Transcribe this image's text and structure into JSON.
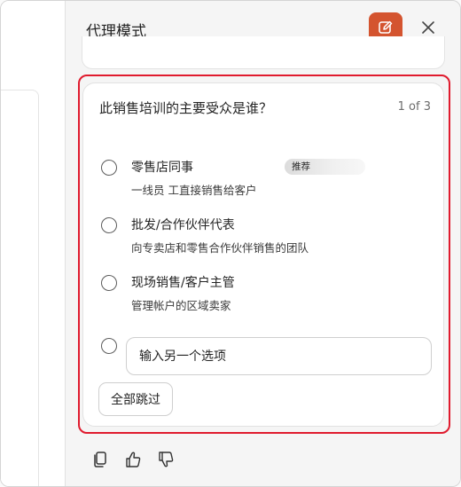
{
  "panel": {
    "title": "代理模式",
    "compose_icon": "compose-icon",
    "close_icon": "close-icon",
    "accent_color": "#d4542f",
    "highlight_color": "#e01b2e"
  },
  "question": {
    "text": "此销售培训的主要受众是谁？",
    "counter": "1 of 3",
    "options": [
      {
        "title": "零售店同事",
        "badge": "推荐",
        "description": "一线员 工直接销售给客户"
      },
      {
        "title": "批发/合作伙伴代表",
        "description": "向专卖店和零售合作伙伴销售的团队"
      },
      {
        "title": "现场销售/客户主管",
        "description": "管理帐户的区域卖家"
      }
    ],
    "other_placeholder": "输入另一个选项",
    "skip_all_label": "全部跳过"
  },
  "feedback": {
    "icons": [
      "copy-icon",
      "thumbs-up-icon",
      "thumbs-down-icon"
    ]
  }
}
